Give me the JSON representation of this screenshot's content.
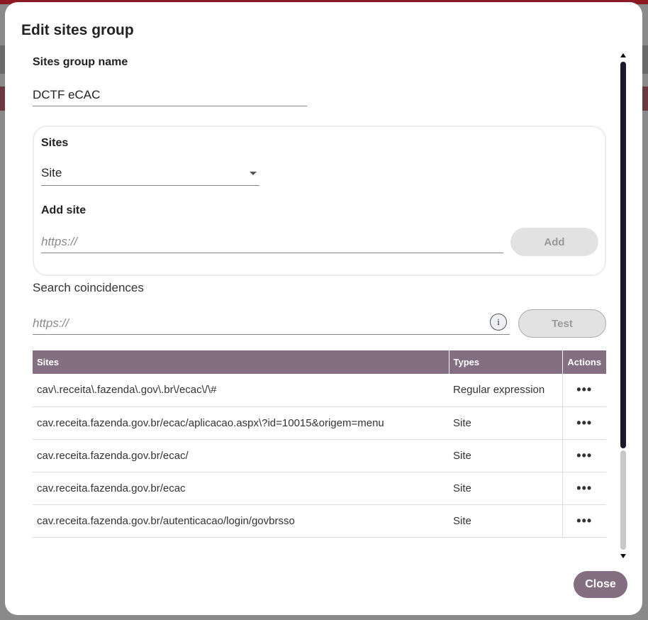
{
  "dialog": {
    "title": "Edit sites group",
    "group_name_label": "Sites group name",
    "group_name_value": "DCTF eCAC",
    "sites_section": {
      "title": "Sites",
      "select_value": "Site",
      "add_site_label": "Add site",
      "add_site_placeholder": "https://",
      "add_button": "Add"
    },
    "search": {
      "label": "Search coincidences",
      "placeholder": "https://",
      "info_icon_glyph": "i",
      "test_button": "Test"
    },
    "table": {
      "headers": [
        "Sites",
        "Types",
        "Actions"
      ],
      "rows": [
        {
          "site": "cav\\.receita\\.fazenda\\.gov\\.br\\/ecac\\/\\#",
          "type": "Regular expression",
          "action": "•••"
        },
        {
          "site": "cav.receita.fazenda.gov.br/ecac/aplicacao.aspx\\?id=10015&origem=menu",
          "type": "Site",
          "action": "•••"
        },
        {
          "site": "cav.receita.fazenda.gov.br/ecac/",
          "type": "Site",
          "action": "•••"
        },
        {
          "site": "cav.receita.fazenda.gov.br/ecac",
          "type": "Site",
          "action": "•••"
        },
        {
          "site": "cav.receita.fazenda.gov.br/autenticacao/login/govbrsso",
          "type": "Site",
          "action": "•••"
        }
      ]
    },
    "close_button": "Close"
  },
  "colors": {
    "accent": "#836f81",
    "disabled_button": "#e2e2e2",
    "scrollbar_thumb": "#1a1a2a"
  }
}
